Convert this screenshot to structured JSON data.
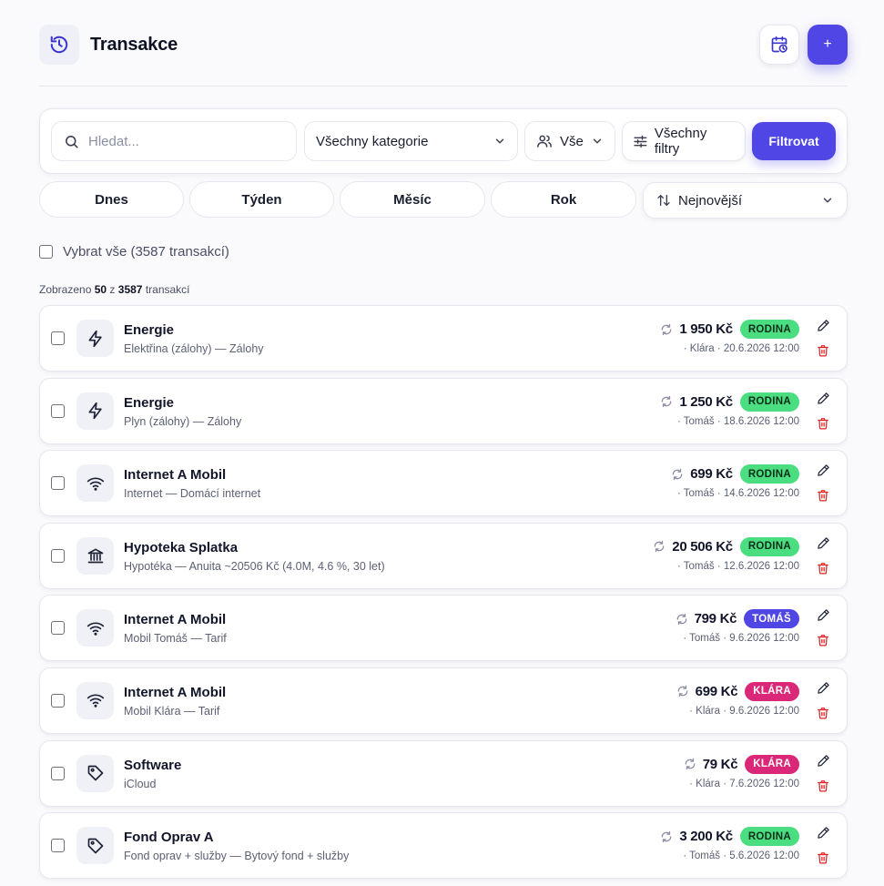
{
  "header": {
    "title": "Transakce",
    "add_label": "+"
  },
  "filters": {
    "search_placeholder": "Hledat...",
    "category": "Všechny kategorie",
    "person": "Vše",
    "all_filters": "Všechny filtry",
    "submit": "Filtrovat"
  },
  "periods": [
    "Dnes",
    "Týden",
    "Měsíc",
    "Rok"
  ],
  "sort": {
    "label": "Nejnovější"
  },
  "select_all": "Vybrat vše (3587 transakcí)",
  "summary": {
    "prefix": "Zobrazeno",
    "shown": "50",
    "mid": "z",
    "total": "3587",
    "suffix": "transakcí"
  },
  "colors": {
    "accent": "#4f46e5",
    "rodina": "#4ade80",
    "tomas": "#4f46e5",
    "klara": "#db2777",
    "delete": "#dc2626"
  },
  "transactions": [
    {
      "icon": "bolt-icon",
      "title": "Energie",
      "subtitle": "Elektřina (zálohy) — Zálohy",
      "amount": "1 950 Kč",
      "badge": "RODINA",
      "badge_color": "green",
      "meta": "· Klára · 20.6.2026 12:00"
    },
    {
      "icon": "bolt-icon",
      "title": "Energie",
      "subtitle": "Plyn (zálohy) — Zálohy",
      "amount": "1 250 Kč",
      "badge": "RODINA",
      "badge_color": "green",
      "meta": "· Tomáš · 18.6.2026 12:00"
    },
    {
      "icon": "wifi-icon",
      "title": "Internet A Mobil",
      "subtitle": "Internet — Domácí internet",
      "amount": "699 Kč",
      "badge": "RODINA",
      "badge_color": "green",
      "meta": "· Tomáš · 14.6.2026 12:00"
    },
    {
      "icon": "bank-icon",
      "title": "Hypoteka Splatka",
      "subtitle": "Hypotéka — Anuita ~20506 Kč (4.0M, 4.6 %, 30 let)",
      "amount": "20 506 Kč",
      "badge": "RODINA",
      "badge_color": "green",
      "meta": "· Tomáš · 12.6.2026 12:00"
    },
    {
      "icon": "wifi-icon",
      "title": "Internet A Mobil",
      "subtitle": "Mobil Tomáš — Tarif",
      "amount": "799 Kč",
      "badge": "TOMÁŠ",
      "badge_color": "indigo",
      "meta": "· Tomáš · 9.6.2026 12:00"
    },
    {
      "icon": "wifi-icon",
      "title": "Internet A Mobil",
      "subtitle": "Mobil Klára — Tarif",
      "amount": "699 Kč",
      "badge": "KLÁRA",
      "badge_color": "pink",
      "meta": "· Klára · 9.6.2026 12:00"
    },
    {
      "icon": "tag-icon",
      "title": "Software",
      "subtitle": "iCloud",
      "amount": "79 Kč",
      "badge": "KLÁRA",
      "badge_color": "pink",
      "meta": "· Klára · 7.6.2026 12:00"
    },
    {
      "icon": "tag-icon",
      "title": "Fond Oprav A",
      "subtitle": "Fond oprav + služby — Bytový fond + služby",
      "amount": "3 200 Kč",
      "badge": "RODINA",
      "badge_color": "green",
      "meta": "· Tomáš · 5.6.2026 12:00"
    }
  ]
}
